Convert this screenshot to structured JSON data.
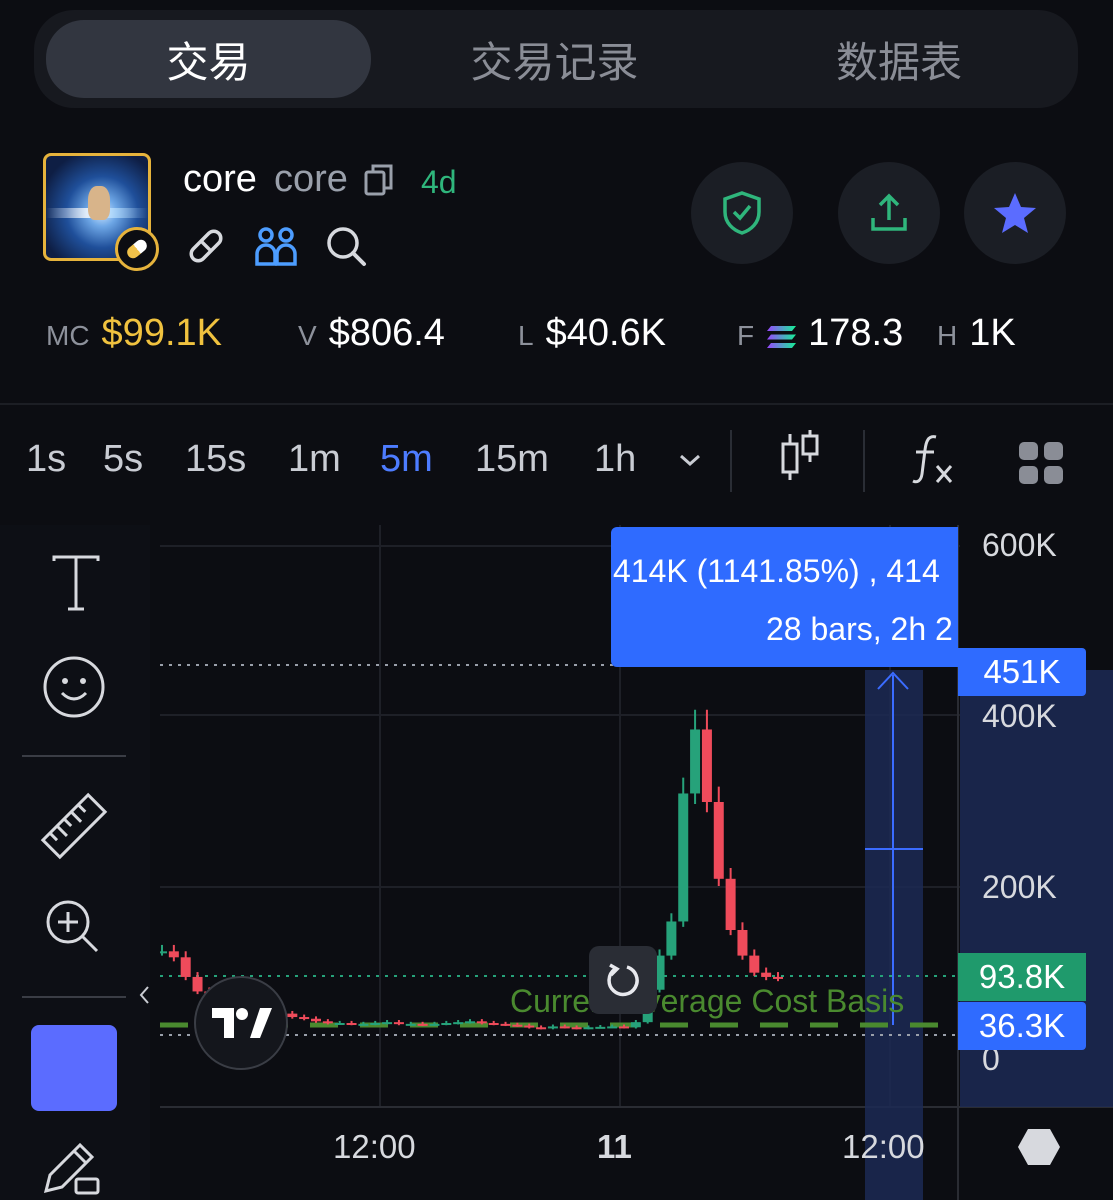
{
  "tabs": [
    {
      "label": "交易",
      "active": true
    },
    {
      "label": "交易记录",
      "active": false
    },
    {
      "label": "数据表",
      "active": false
    }
  ],
  "token": {
    "name": "core",
    "symbol": "core",
    "age": "4d"
  },
  "header_icons": [
    "link-icon",
    "holders-icon",
    "search-icon"
  ],
  "actions": [
    "shield-check-icon",
    "share-icon",
    "star-icon"
  ],
  "stats": {
    "mc_label": "MC",
    "mc_value": "$99.1K",
    "v_label": "V",
    "v_value": "$806.4",
    "l_label": "L",
    "l_value": "$40.6K",
    "f_label": "F",
    "f_value": "178.3",
    "h_label": "H",
    "h_value": "1K"
  },
  "intervals": [
    "1s",
    "5s",
    "15s",
    "1m",
    "5m",
    "15m",
    "1h"
  ],
  "active_interval": "5m",
  "measure": {
    "line1": "414K (1141.85%) , 414",
    "line2": "28 bars, 2h 2"
  },
  "cost_basis_label": "Current Average Cost Basis",
  "price_tags": {
    "high": "451K",
    "current": "93.8K",
    "cost": "36.3K"
  },
  "colors": {
    "up": "#26a27a",
    "down": "#ef4b5b",
    "accent": "#4d7cff",
    "mc": "#f0c23f",
    "cost_line": "#4a8a2f"
  },
  "chart_data": {
    "type": "candlestick",
    "y_ticks": [
      "600K",
      "400K",
      "200K",
      "0"
    ],
    "x_ticks": [
      "12:00",
      "11",
      "12:00"
    ],
    "ylim": [
      0,
      600000
    ],
    "close": [
      125000,
      118000,
      95000,
      78000,
      72000,
      70000,
      66000,
      64000,
      62000,
      58000,
      52000,
      48000,
      46000,
      43000,
      41000,
      41000,
      40000,
      40000,
      41000,
      42000,
      40000,
      40000,
      39000,
      40000,
      41000,
      42000,
      43000,
      41000,
      40000,
      39000,
      38000,
      36000,
      35000,
      37000,
      36000,
      35000,
      36000,
      36500,
      37000,
      36000,
      42000,
      80000,
      120000,
      160000,
      310000,
      385000,
      300000,
      210000,
      150000,
      120000,
      100000,
      95000,
      93800
    ]
  }
}
